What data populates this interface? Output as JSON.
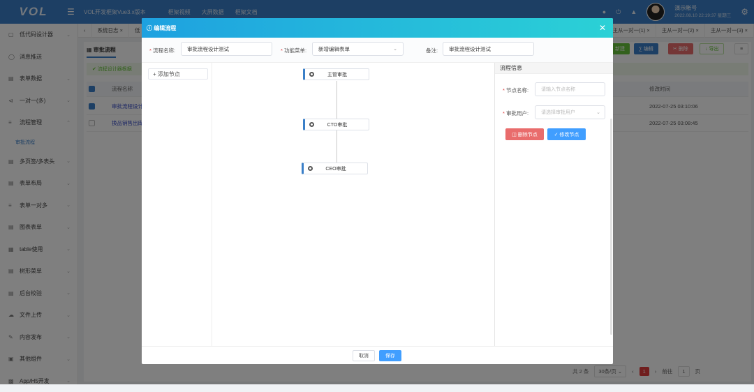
{
  "app": {
    "logo": "VOL",
    "menu_icon": "hamburger-icon",
    "top_links": [
      "VOL开发框架Vue3.x版本",
      "框架视频",
      "大屏数据",
      "框架文档"
    ],
    "user_name": "演示帐号",
    "user_time": "2022.08.10 22:19:37 星期三"
  },
  "sidebar": {
    "items": [
      {
        "label": "低代码设计器",
        "icon": "form-icon"
      },
      {
        "label": "消息推送",
        "icon": "chat-icon"
      },
      {
        "label": "表单数据",
        "icon": "table-icon"
      },
      {
        "label": "一对一(多)",
        "icon": "share-icon"
      },
      {
        "label": "流程管理",
        "icon": "sliders-icon"
      },
      {
        "label": "多页签/多表头",
        "icon": "tabs-icon"
      },
      {
        "label": "表单布局",
        "icon": "layout-icon"
      },
      {
        "label": "表单一对多",
        "icon": "sliders-icon"
      },
      {
        "label": "图表表单",
        "icon": "chart-icon"
      },
      {
        "label": "table使用",
        "icon": "grid-icon"
      },
      {
        "label": "树形菜单",
        "icon": "tree-icon"
      },
      {
        "label": "后台校验",
        "icon": "check-icon"
      },
      {
        "label": "文件上传",
        "icon": "upload-icon"
      },
      {
        "label": "内容发布",
        "icon": "edit-icon"
      },
      {
        "label": "其他组件",
        "icon": "folder-icon"
      },
      {
        "label": "App/H5开发",
        "icon": "apps-icon"
      }
    ],
    "sub_item": "审批流程"
  },
  "tabs": {
    "left": [
      "系统日志",
      "低"
    ],
    "right": [
      "主从一对一(1)",
      "主从一对一(2)",
      "主从一对一(3)"
    ]
  },
  "main": {
    "title": "审批流程",
    "alert": "流程设计器根据",
    "buttons": [
      "新建",
      "编辑",
      "删除",
      "导出"
    ],
    "columns": [
      "流程名称",
      "修改时间"
    ],
    "rows": [
      {
        "name": "审批流程设计",
        "time": "2022-07-25 03:10:06",
        "checked": true
      },
      {
        "name": "换品销售出库",
        "time": "2022-07-25 03:08:45",
        "checked": false
      }
    ],
    "pager": {
      "total": "共 2 条",
      "per_page": "30条/页",
      "current": "1",
      "goto_label": "前往",
      "goto_value": "1",
      "page_suffix": "页"
    }
  },
  "modal": {
    "title": "编辑流程",
    "form": {
      "name_label": "流程名称:",
      "name_value": "审批流程设计测试",
      "menu_label": "功能菜单:",
      "menu_value": "新增编辑表单",
      "remark_label": "备注:",
      "remark_value": "审批流程设计测试"
    },
    "add_node_label": "添加节点",
    "nodes": [
      {
        "label": "主管审批"
      },
      {
        "label": "CTO审批"
      },
      {
        "label": "CEO审批"
      }
    ],
    "panel": {
      "title": "流程信息",
      "node_name_label": "节点名称:",
      "node_name_placeholder": "请输入节点名称",
      "approver_label": "审批用户:",
      "approver_placeholder": "请选择审批用户",
      "delete_label": "删除节点",
      "modify_label": "修改节点"
    },
    "cancel_label": "取消",
    "save_label": "保存"
  },
  "colors": {
    "primary": "#3a7fc8",
    "danger": "#e96c6c",
    "success": "#67c23a",
    "modify": "#409eff"
  }
}
